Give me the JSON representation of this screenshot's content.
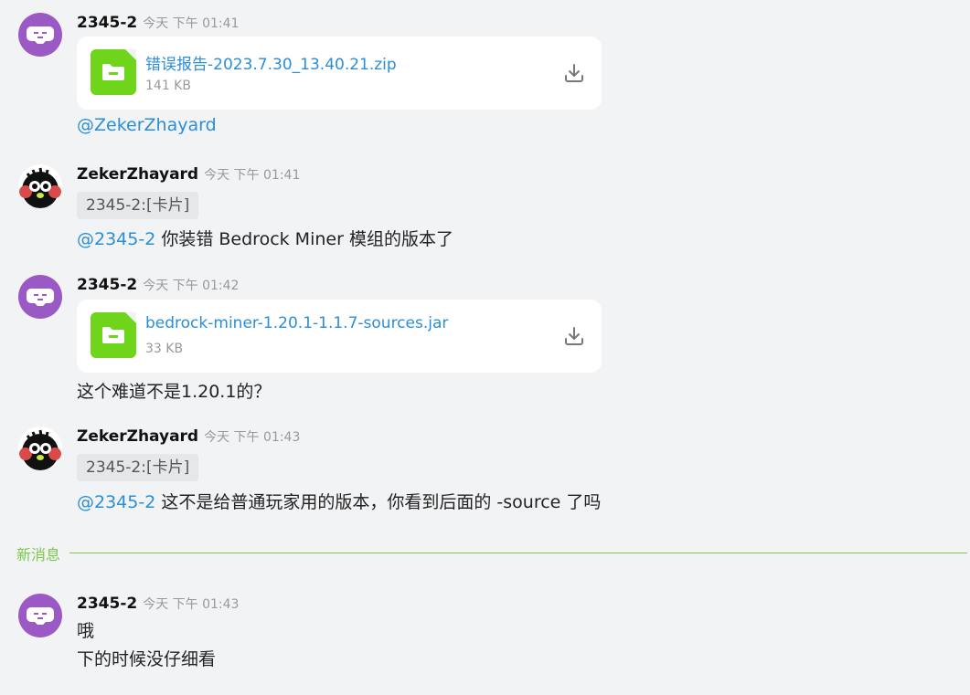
{
  "messages": [
    {
      "sender": "2345-2",
      "time": "今天 下午 01:41",
      "file": {
        "name": "错误报告-2023.7.30_13.40.21.zip",
        "size": "141 KB"
      },
      "text_mention": "@ZekerZhayard"
    },
    {
      "sender": "ZekerZhayard",
      "time": "今天 下午 01:41",
      "reply_chip": "2345-2:[卡片]",
      "mention": "@2345-2",
      "text": " 你装错 Bedrock Miner 模组的版本了"
    },
    {
      "sender": "2345-2",
      "time": "今天 下午 01:42",
      "file": {
        "name": "bedrock-miner-1.20.1-1.1.7-sources.jar",
        "size": "33 KB"
      },
      "text": "这个难道不是1.20.1的？"
    },
    {
      "sender": "ZekerZhayard",
      "time": "今天 下午 01:43",
      "reply_chip": "2345-2:[卡片]",
      "mention": "@2345-2",
      "text": " 这不是给普通玩家用的版本，你看到后面的 -source 了吗"
    },
    {
      "sender": "2345-2",
      "time": "今天 下午 01:43",
      "lines": [
        "哦",
        "下的时候没仔细看"
      ]
    }
  ],
  "divider": {
    "label": "新消息"
  },
  "colors": {
    "accent": "#2a8ed8",
    "divider": "#7cc94a",
    "file_icon": "#6ed51a",
    "bot_avatar": "#9b59c6"
  },
  "icons": {
    "bot_avatar": "gamepad-face-icon",
    "file": "folder-icon",
    "download": "download-icon"
  }
}
